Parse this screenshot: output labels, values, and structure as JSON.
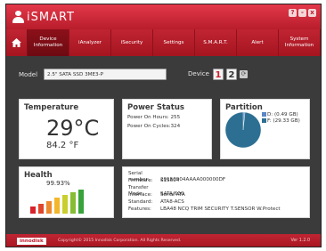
{
  "app": {
    "name": "iSMART"
  },
  "window_buttons": [
    "?",
    "-",
    "x"
  ],
  "nav": {
    "tabs": [
      {
        "label": "Device Information",
        "active": true
      },
      {
        "label": "iAnalyzer"
      },
      {
        "label": "iSecurity"
      },
      {
        "label": "Settings"
      },
      {
        "label": "S.M.A.R.T."
      },
      {
        "label": "Alert"
      },
      {
        "label": "System Information"
      }
    ]
  },
  "model": {
    "label": "Model",
    "value": "2.5\" SATA SSD 3ME3-P"
  },
  "device": {
    "label": "Device",
    "options": [
      "1",
      "2"
    ],
    "selected": "1"
  },
  "temperature": {
    "title": "Temperature",
    "celsius": "29°C",
    "fahrenheit": "84.2 °F"
  },
  "power": {
    "title": "Power Status",
    "on_hours": "Power On Hours: 255",
    "on_cycles": "Power On Cycles:324"
  },
  "partition": {
    "title": "Partition",
    "items": [
      {
        "label": "D: (0.49 GB)",
        "color": "#5a86c6",
        "gb": 0.49
      },
      {
        "label": "F: (29.33 GB)",
        "color": "#2c6f93",
        "gb": 29.33
      }
    ]
  },
  "health": {
    "title": "Health",
    "value": "99.93%",
    "bar_colors": [
      "#d8232a",
      "#e0462a",
      "#ec8a2d",
      "#f2b72b",
      "#c9cf2c",
      "#86bd33",
      "#38a33a"
    ]
  },
  "info": {
    "rows": [
      {
        "key": "Serial number:",
        "value": "20150904AAAA000000DF"
      },
      {
        "key": "Firmware:",
        "value": "S15604"
      },
      {
        "key": "Transfer Mode:",
        "value": "SATA/600"
      },
      {
        "key": "Interface:",
        "value": "Serial ATA"
      },
      {
        "key": "Standard:",
        "value": "ATA8-ACS"
      },
      {
        "key": "Features:",
        "value": "LBA48 NCQ TRIM SECURITY T.SENSOR W.Protect"
      }
    ]
  },
  "footer": {
    "brand": "innodisk",
    "copyright": "Copyright© 2015 Innodisk Corporation. All Rights Reserved.",
    "version": "Ver 1.2.0"
  }
}
